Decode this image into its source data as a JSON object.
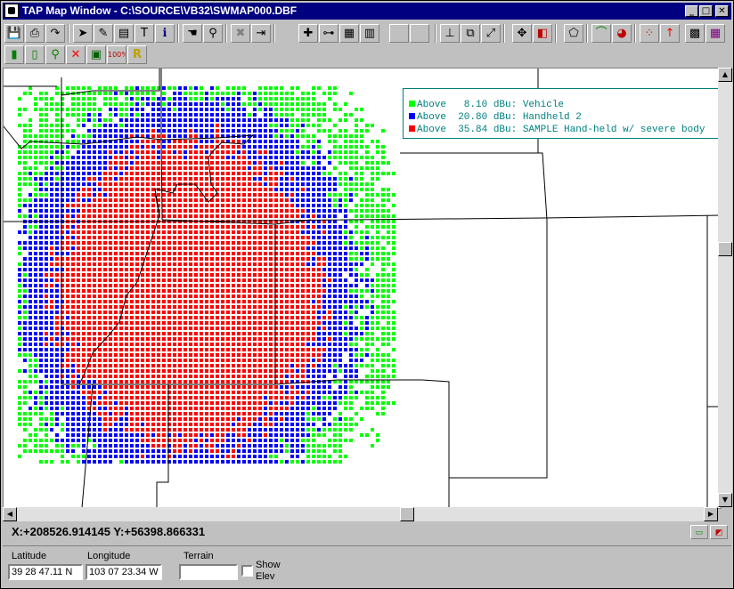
{
  "window": {
    "title": "TAP Map Window - C:\\SOURCE\\VB32\\SWMAP000.DBF"
  },
  "legend": [
    {
      "label": "Above   8.10 dBu: Vehicle",
      "color": "#00ff00"
    },
    {
      "label": "Above  20.80 dBu: Handheld 2",
      "color": "#0000ff"
    },
    {
      "label": "Above  35.84 dBu: SAMPLE Hand-held w/ severe body",
      "color": "#ff0000"
    }
  ],
  "status": {
    "coordinates": "X:+208526.914145 Y:+56398.866331"
  },
  "fields": {
    "latitude_label": "Latitude",
    "latitude": "39 28 47.11 N",
    "longitude_label": "Longitude",
    "longitude": "103 07 23.34 W",
    "terrain_label": "Terrain",
    "terrain": "",
    "show_elev_label": "Show\nElev",
    "show_elev": false
  },
  "toolbar1": [
    "save-icon",
    "print-icon",
    "redo-icon",
    "pointer-icon",
    "layer-edit-icon",
    "stack-icon",
    "text-icon",
    "info-icon",
    "hand-icon",
    "zoom-icon",
    "delete-icon",
    "exit-icon",
    "crosshair-icon",
    "ruler-icon",
    "grid-icon",
    "notes-icon",
    "blank-icon",
    "blank-icon",
    "axis-icon",
    "zoom-box-icon",
    "expand-icon",
    "move-icon",
    "overlay-icon",
    "polygon-icon",
    "profile-icon",
    "coverage-icon",
    "points-icon",
    "arrow-up-icon",
    "grid-color-icon",
    "palette-icon"
  ],
  "toolbar2": [
    "tower-icon",
    "site-icon",
    "search-icon",
    "cancel-icon",
    "chart-icon",
    "zoom-100-icon",
    "text-format-icon"
  ],
  "colors": {
    "vehicle": "#00ff00",
    "handheld": "#0000ff",
    "severe": "#ff0000",
    "boundary": "#000000"
  }
}
